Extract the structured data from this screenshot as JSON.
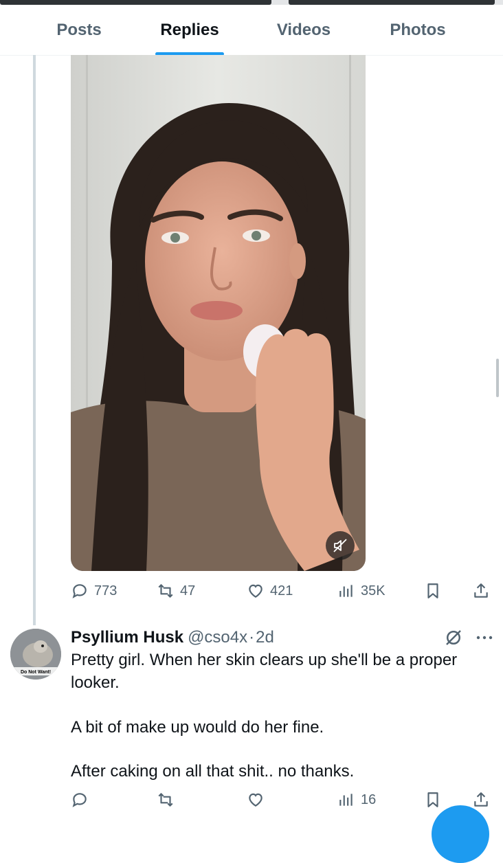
{
  "tabs": [
    {
      "label": "Posts"
    },
    {
      "label": "Replies"
    },
    {
      "label": "Videos"
    },
    {
      "label": "Photos"
    }
  ],
  "active_tab": "Replies",
  "accent_color": "#1d9bf0",
  "video": {
    "icons": [
      "mute-icon"
    ]
  },
  "post_actions": {
    "reply_count": "773",
    "repost_count": "47",
    "like_count": "421",
    "views_count": "35K"
  },
  "reply": {
    "display_name": "Psyllium Husk",
    "handle": "@cso4x",
    "separator": "·",
    "time": "2d",
    "avatar_text": "Do Not Want!",
    "paragraphs": [
      "Pretty girl. When her skin clears up she'll be a proper looker.",
      "A bit of make up would do her fine.",
      "After caking on all that shit.. no thanks."
    ],
    "actions": {
      "reply_count": "",
      "repost_count": "",
      "like_count": "",
      "views_count": "16"
    }
  },
  "icons": [
    "reply-icon",
    "repost-icon",
    "like-icon",
    "views-icon",
    "bookmark-icon",
    "share-icon",
    "grok-icon",
    "more-icon"
  ]
}
